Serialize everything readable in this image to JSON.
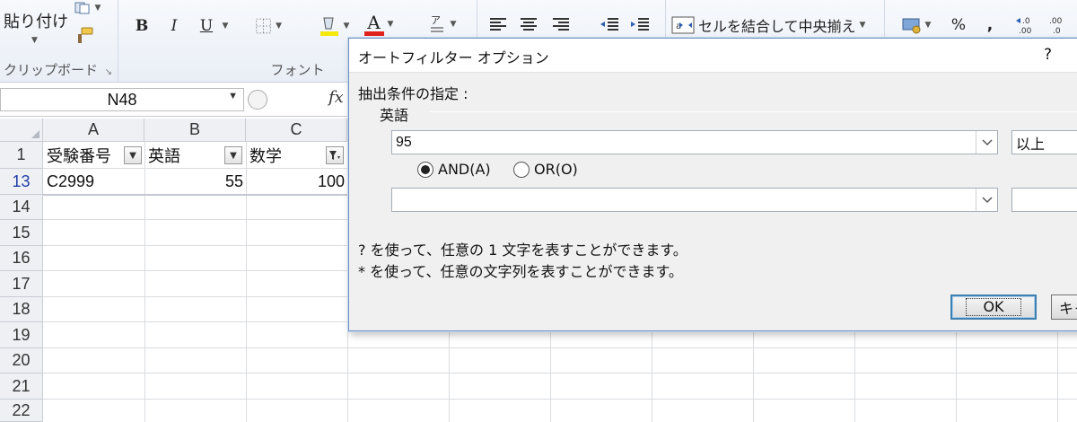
{
  "ribbon": {
    "clipboard": {
      "paste_label": "貼り付け",
      "group_label": "クリップボード"
    },
    "font": {
      "group_label": "フォント",
      "bold": "B",
      "italic": "I",
      "underline": "U",
      "font_color": "A"
    },
    "alignment": {
      "merge_center_label": "セルを結合して中央揃え"
    },
    "number": {
      "percent": "%",
      "comma": ","
    }
  },
  "formula_bar": {
    "name_box": "N48",
    "fx_label": "fx"
  },
  "grid": {
    "columns": [
      "A",
      "B",
      "C"
    ],
    "rows": [
      "1",
      "13",
      "14",
      "15",
      "16",
      "17",
      "18",
      "19",
      "20",
      "21",
      "22"
    ],
    "header_row": {
      "a": "受験番号",
      "b": "英語",
      "c": "数学"
    },
    "row13": {
      "a": "C2999",
      "b": "55",
      "c": "100"
    }
  },
  "dialog": {
    "title": "オートフィルター オプション",
    "help": "?",
    "criteria_label": "抽出条件の指定 :",
    "field_name": "英語",
    "condition1": {
      "value": "95",
      "operator": "以上"
    },
    "condition2": {
      "value": "",
      "operator": ""
    },
    "and_label": "AND(A)",
    "or_label": "OR(O)",
    "selected_logic": "AND",
    "hint1": "? を使って、任意の 1 文字を表すことができます。",
    "hint2": "* を使って、任意の文字列を表すことができます。",
    "ok_label": "OK",
    "cancel_label": "キャンセル"
  },
  "colors": {
    "dialog_border": "#6c8fbf",
    "filtered_row": "#1f3ea8",
    "ok_border": "#3c7fb1"
  }
}
